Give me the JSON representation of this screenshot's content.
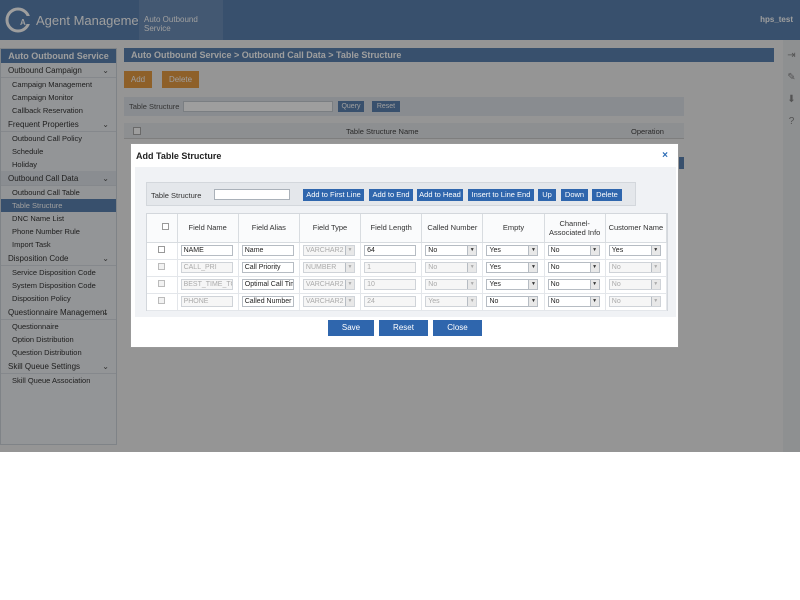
{
  "header": {
    "app_title": "Agent Management",
    "active_tab": "Auto Outbound Service",
    "user": "hps_test",
    "logo_letters": "C"
  },
  "sidebar": {
    "title": "Auto Outbound Service",
    "groups": [
      {
        "label": "Outbound Campaign",
        "items": [
          "Campaign Management",
          "Campaign Monitor",
          "Callback Reservation"
        ]
      },
      {
        "label": "Frequent Properties",
        "items": [
          "Outbound Call Policy",
          "Schedule",
          "Holiday"
        ]
      },
      {
        "label": "Outbound Call Data",
        "items": [
          "Outbound Call Table",
          "Table Structure",
          "DNC Name List",
          "Phone Number Rule",
          "Import Task"
        ]
      },
      {
        "label": "Disposition Code",
        "items": [
          "Service Disposition Code",
          "System Disposition Code",
          "Disposition Policy"
        ]
      },
      {
        "label": "Questionnaire Management",
        "items": [
          "Questionnaire",
          "Option Distribution",
          "Question Distribution"
        ]
      },
      {
        "label": "Skill Queue Settings",
        "items": [
          "Skill Queue Association"
        ]
      }
    ],
    "selected_item": "Table Structure"
  },
  "breadcrumb": "Auto Outbound Service > Outbound Call Data > Table Structure",
  "main": {
    "add_label": "Add",
    "delete_label": "Delete",
    "query_label": "Table Structure",
    "query_button": "Query",
    "reset_button": "Reset",
    "table_col_name": "Table Structure Name",
    "table_col_op": "Operation"
  },
  "modal": {
    "title": "Add Table Structure",
    "close": "×",
    "table_structure_label": "Table Structure",
    "table_structure_value": "",
    "toolbar": [
      "Add to First Line",
      "Add to End",
      "Add to Head",
      "Insert to Line End",
      "Up",
      "Down",
      "Delete"
    ],
    "columns": [
      "Field Name",
      "Field Alias",
      "Field Type",
      "Field Length",
      "Called Number",
      "Empty",
      "Channel-Associated Info",
      "Customer Name"
    ],
    "rows": [
      {
        "name": "NAME",
        "alias": "Name",
        "type": "VARCHAR2",
        "length": "64",
        "called": "No",
        "empty": "Yes",
        "channel": "No",
        "customer": "Yes",
        "disabled": false
      },
      {
        "name": "CALL_PRI",
        "alias": "Call Priority",
        "type": "NUMBER",
        "length": "1",
        "called": "No",
        "empty": "Yes",
        "channel": "No",
        "customer": "No",
        "disabled": true
      },
      {
        "name": "BEST_TIME_TO",
        "alias": "Optimal Call Time",
        "type": "VARCHAR2",
        "length": "10",
        "called": "No",
        "empty": "Yes",
        "channel": "No",
        "customer": "No",
        "disabled": true
      },
      {
        "name": "PHONE",
        "alias": "Called Number",
        "type": "VARCHAR2",
        "length": "24",
        "called": "Yes",
        "empty": "No",
        "channel": "No",
        "customer": "No",
        "disabled": true
      }
    ],
    "save_label": "Save",
    "reset_label": "Reset",
    "close_label": "Close"
  },
  "right_icons": [
    "export-icon",
    "wrench-icon",
    "download-icon",
    "help-icon"
  ]
}
